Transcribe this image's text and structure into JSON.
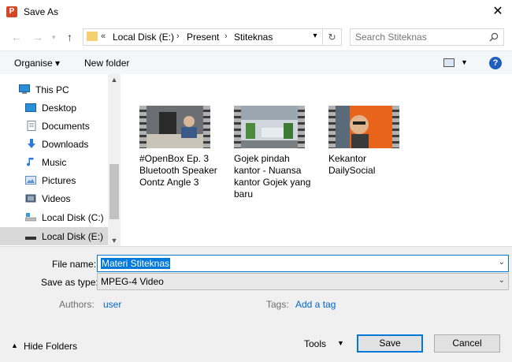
{
  "window": {
    "title": "Save As",
    "app_icon_letter": "P"
  },
  "address": {
    "overflow": "«",
    "crumbs": [
      "Local Disk (E:)",
      "Present",
      "Stiteknas"
    ],
    "separator": "›"
  },
  "search": {
    "placeholder": "Search Stiteknas"
  },
  "toolbar": {
    "organise": "Organise ▾",
    "new_folder": "New folder"
  },
  "sidebar": {
    "items": [
      {
        "label": "This PC",
        "icon": "computer-icon",
        "color": "#2b8fd8"
      },
      {
        "label": "Desktop",
        "icon": "desktop-icon",
        "color": "#2b8fd8"
      },
      {
        "label": "Documents",
        "icon": "documents-icon",
        "color": "#9aa5b1"
      },
      {
        "label": "Downloads",
        "icon": "downloads-icon",
        "color": "#2b79d8"
      },
      {
        "label": "Music",
        "icon": "music-icon",
        "color": "#2b79d8"
      },
      {
        "label": "Pictures",
        "icon": "pictures-icon",
        "color": "#5a8fc8"
      },
      {
        "label": "Videos",
        "icon": "videos-icon",
        "color": "#4a5f7a"
      },
      {
        "label": "Local Disk (C:)",
        "icon": "drive-c-icon",
        "color": "#5d8fb8"
      },
      {
        "label": "Local Disk (E:)",
        "icon": "drive-e-icon",
        "color": "#333333"
      }
    ],
    "selected_index": 8
  },
  "files": [
    {
      "name": "#OpenBox Ep. 3 Bluetooth Speaker Oontz Angle 3"
    },
    {
      "name": "Gojek pindah kantor - Nuansa kantor Gojek yang baru"
    },
    {
      "name": "Kekantor DailySocial"
    }
  ],
  "form": {
    "file_name_label": "File name:",
    "file_name_value": "Materi Stiteknas",
    "save_type_label": "Save as type:",
    "save_type_value": "MPEG-4 Video",
    "authors_label": "Authors:",
    "authors_value": "user",
    "tags_label": "Tags:",
    "tags_value": "Add a tag"
  },
  "footer": {
    "hide_folders": "Hide Folders",
    "tools": "Tools",
    "save": "Save",
    "cancel": "Cancel"
  },
  "colors": {
    "accent": "#0078d7",
    "link": "#0066cc",
    "selection": "#d9d9d9"
  }
}
